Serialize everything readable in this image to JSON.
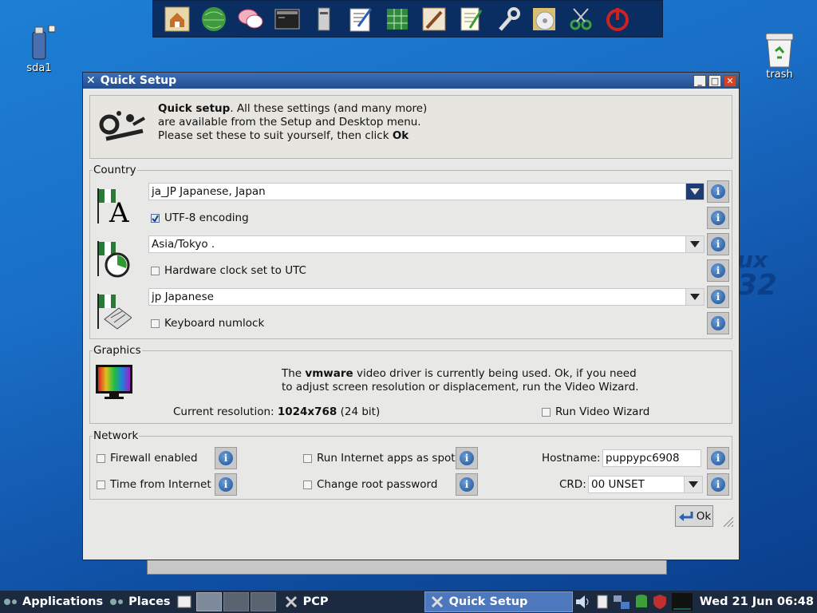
{
  "desktop": {
    "icons": [
      {
        "label": "sda1",
        "icon": "usb-drive-icon"
      },
      {
        "label": "trash",
        "icon": "trash-icon"
      }
    ],
    "wallpaper_text": [
      "ux",
      "32"
    ]
  },
  "dock": {
    "items": [
      "home-icon",
      "globe-icon",
      "chat-icon",
      "terminal-icon",
      "drive-icon",
      "editor-icon",
      "spreadsheet-icon",
      "paint-icon",
      "notes-icon",
      "wrench-icon",
      "disc-icon",
      "scissors-icon",
      "power-icon"
    ]
  },
  "window": {
    "title": "Quick Setup",
    "header": {
      "line1_bold": "Quick setup",
      "line1_rest": ". All these settings (and many more)",
      "line2": "are available from the Setup and Desktop menu.",
      "line3_pre": "Please set these to suit yourself, then click ",
      "line3_bold": "Ok"
    },
    "country": {
      "label": "Country",
      "locale_value": "ja_JP        Japanese, Japan",
      "utf8_label": "UTF-8 encoding",
      "utf8_checked": true,
      "timezone_value": "Asia/Tokyo       .",
      "hwclock_label": "Hardware clock set to UTC",
      "hwclock_checked": false,
      "keyboard_value": "jp     Japanese",
      "numlock_label": "Keyboard numlock",
      "numlock_checked": false
    },
    "graphics": {
      "label": "Graphics",
      "line1_pre": "The ",
      "line1_bold": "vmware",
      "line1_post": " video driver is currently being used. Ok, if you need",
      "line2": "to adjust screen resolution or displacement, run the Video Wizard.",
      "res_label": "Current resolution: ",
      "res_value": "1024x768",
      "res_bits": "  (24 bit)",
      "wizard_label": "Run Video Wizard"
    },
    "network": {
      "label": "Network",
      "firewall_label": "Firewall enabled",
      "time_label": "Time from Internet",
      "spot_label": "Run Internet apps as spot",
      "rootpw_label": "Change root password",
      "hostname_label": "Hostname:",
      "hostname_value": "puppypc6908",
      "crd_label": "CRD:",
      "crd_value": "00 UNSET"
    },
    "ok_label": "Ok"
  },
  "taskbar": {
    "applications": "Applications",
    "places": "Places",
    "task1": "PCP",
    "task2": "Quick Setup",
    "clock": "Wed 21 Jun 06:48"
  },
  "colors": {
    "accent": "#244d8e",
    "taskbar": "#1c2a40",
    "window_bg": "#e8e8e6"
  }
}
